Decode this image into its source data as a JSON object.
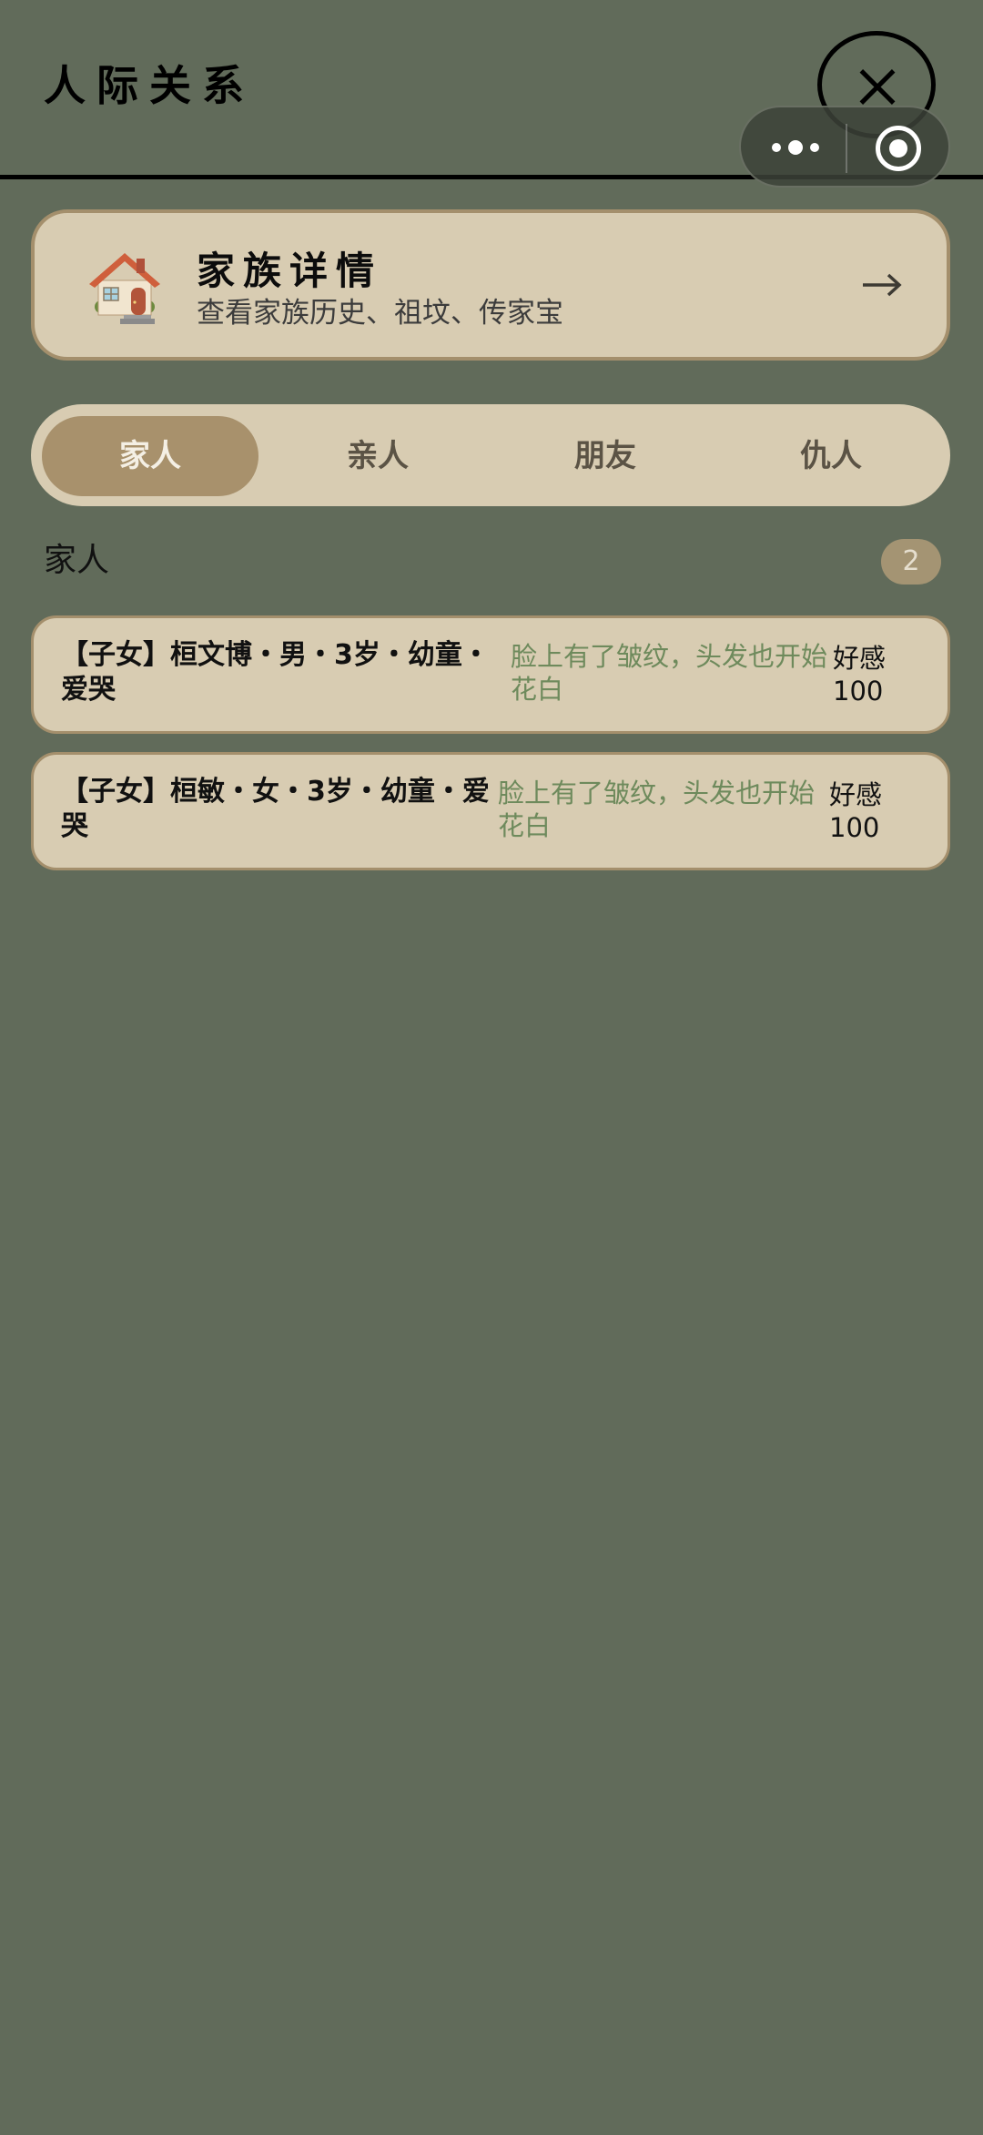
{
  "header": {
    "title": "人际关系"
  },
  "capsule": {
    "more_icon": "more-dots-icon",
    "target_icon": "target-icon"
  },
  "family_card": {
    "title": "家族详情",
    "subtitle": "查看家族历史、祖坟、传家宝",
    "icon": "house-icon",
    "arrow": "arrow-right-icon"
  },
  "tabs": [
    {
      "label": "家人",
      "active": true
    },
    {
      "label": "亲人",
      "active": false
    },
    {
      "label": "朋友",
      "active": false
    },
    {
      "label": "仇人",
      "active": false
    }
  ],
  "section": {
    "label": "家人",
    "count": "2"
  },
  "relations": [
    {
      "name": "【子女】桓文博・男・3岁・幼童・爱哭",
      "status": "脸上有了皱纹，头发也开始花白",
      "favor_label": "好感",
      "favor_value": "100"
    },
    {
      "name": "【子女】桓敏・女・3岁・幼童・爱哭",
      "status": "脸上有了皱纹，头发也开始花白",
      "favor_label": "好感",
      "favor_value": "100"
    }
  ],
  "colors": {
    "background": "#616b5a",
    "card": "#d8ccb2",
    "card_border": "#a48f6c",
    "active_tab": "#a8916c",
    "status_text": "#6e8a5c"
  }
}
